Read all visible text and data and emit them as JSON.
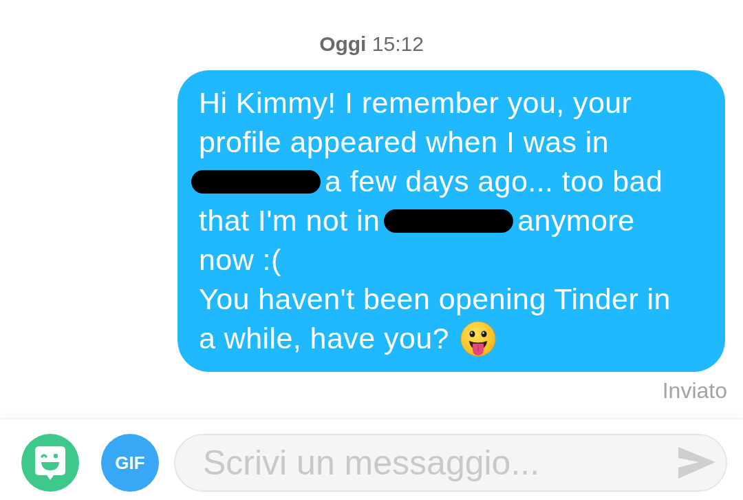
{
  "header": {
    "timestamp": "**Oggi** 15:12"
  },
  "messages": [
    {
      "kind": "sent",
      "status": "Inviato",
      "lines": [
        [
          {
            "kind": "text",
            "text": "Hi Kimmy! I remember you, your"
          }
        ],
        [
          {
            "kind": "text",
            "text": "profile appeared when I was in"
          }
        ],
        [
          {
            "kind": "redaction"
          },
          {
            "kind": "text",
            "text": "a few days ago... too bad"
          }
        ],
        [
          {
            "kind": "text",
            "text": "that I'm not in"
          },
          {
            "kind": "redaction"
          },
          {
            "kind": "text",
            "text": "anymore"
          }
        ],
        [
          {
            "kind": "text",
            "text": "now :("
          }
        ],
        [
          {
            "kind": "text",
            "text": "You haven't been opening Tinder in"
          }
        ],
        [
          {
            "kind": "text",
            "text": "a while, have you?"
          },
          {
            "kind": "emoji"
          }
        ]
      ]
    }
  ],
  "composer": {
    "gif_label": "GIF",
    "placeholder": "Scrivi un messaggio...",
    "send_disabled": true
  }
}
